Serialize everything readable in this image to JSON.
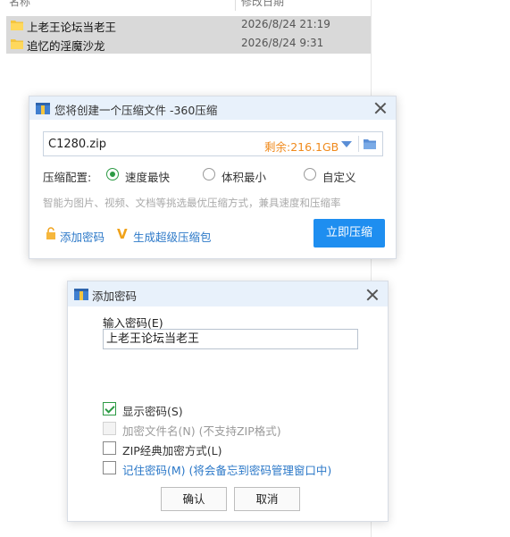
{
  "explorer": {
    "columns": {
      "name": "名称",
      "date": "修改日期"
    },
    "files": [
      {
        "name": "上老王论坛当老王",
        "modified": "2026/8/24 21:19"
      },
      {
        "name": "追忆的淫魔沙龙",
        "modified": "2026/8/24 9:31"
      }
    ]
  },
  "zip_dialog": {
    "title": "您将创建一个压缩文件 -360压缩",
    "filename": "C1280.zip",
    "free_space": "剩余:216.1GB",
    "config_label": "压缩配置:",
    "options": [
      "速度最快",
      "体积最小",
      "自定义"
    ],
    "selected_option": "速度最快",
    "hint": "智能为图片、视频、文档等挑选最优压缩方式，兼具速度和压缩率",
    "add_password_link": "添加密码",
    "super_zip_link": "生成超级压缩包",
    "compress_button": "立即压缩"
  },
  "password_dialog": {
    "title": "添加密码",
    "input_label": "输入密码(E)",
    "password_value": "上老王论坛当老王",
    "show_password": {
      "label": "显示密码(S)",
      "checked": true
    },
    "encrypt_filenames": {
      "label": "加密文件名(N) (不支持ZIP格式)",
      "checked": false,
      "disabled": true
    },
    "zip_classic": {
      "label": "ZIP经典加密方式(L)",
      "checked": false
    },
    "remember": {
      "label": "记住密码(M) (将会备忘到密码管理窗口中)",
      "checked": false
    },
    "ok_button": "确认",
    "cancel_button": "取消"
  },
  "colors": {
    "accent": "#1e8ef0",
    "link": "#2b78c8",
    "free_space": "#f08a1c",
    "radio_selected": "#2c9a44",
    "titlebar": "#e8f1fb",
    "row_selected": "#d9d9d9"
  },
  "icons": [
    "folder-icon",
    "archive-app-icon",
    "close-icon",
    "dropdown-arrow-icon",
    "folder-browse-icon",
    "lock-icon",
    "v-badge-icon"
  ]
}
